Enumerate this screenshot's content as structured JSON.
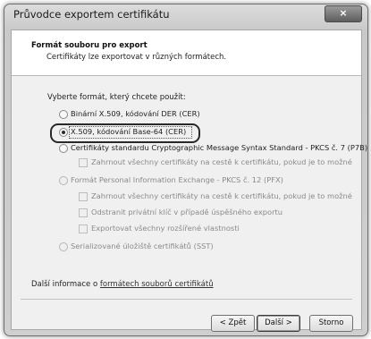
{
  "window": {
    "title": "Průvodce exportem certifikátu",
    "close_glyph": "×"
  },
  "header": {
    "title": "Formát souboru pro export",
    "subtitle": "Certifikáty lze exportovat v různých formátech."
  },
  "prompt": "Vyberte formát, který chcete použít:",
  "options": {
    "der": "Binární X.509, kódování DER (CER)",
    "base64": "X.509, kódování Base-64 (CER)",
    "p7b": "Certifikáty standardu Cryptographic Message Syntax Standard - PKCS č. 7 (P7B)",
    "p7b_include": "Zahrnout všechny certifikáty na cestě k certifikátu, pokud je to možné",
    "pfx": "Formát Personal Information Exchange - PKCS č. 12 (PFX)",
    "pfx_include": "Zahrnout všechny certifikáty na cestě k certifikátu, pokud je to možné",
    "pfx_delete_key": "Odstranit privátní klíč v případě úspěšného exportu",
    "pfx_ext_props": "Exportovat všechny rozšířené vlastnosti",
    "sst": "Serializované úložiště certifikátů (SST)"
  },
  "selected_option": "base64",
  "more_info": {
    "prefix": "Další informace o ",
    "link": "formátech souborů certifikátů"
  },
  "buttons": {
    "back": "< Zpět",
    "next": "Další >",
    "cancel": "Storno"
  }
}
